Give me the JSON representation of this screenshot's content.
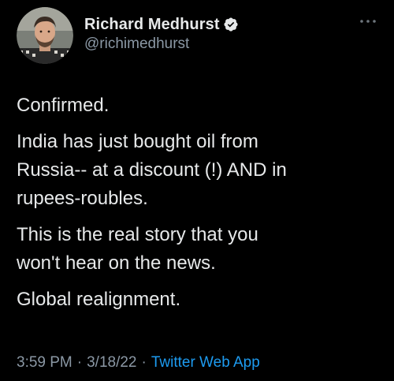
{
  "tweet": {
    "author": {
      "display_name": "Richard Medhurst",
      "handle": "@richimedhurst",
      "verified": true
    },
    "text": {
      "line1": "Confirmed.",
      "line2": "India has just bought oil from\nRussia-- at a discount (!) AND in\nrupees-roubles.",
      "line3": "This is the real story that you\nwon't hear on the news.",
      "line4": "Global realignment."
    },
    "meta": {
      "time": "3:59 PM",
      "separator": "·",
      "date": "3/18/22",
      "source": "Twitter Web App"
    }
  },
  "colors": {
    "background": "#000000",
    "primary_text": "#e7e9ea",
    "secondary_text": "#8b98a5",
    "accent": "#1d9bf0"
  },
  "icons": {
    "verified": "verified-badge-icon",
    "more": "more-horizontal-icon"
  }
}
